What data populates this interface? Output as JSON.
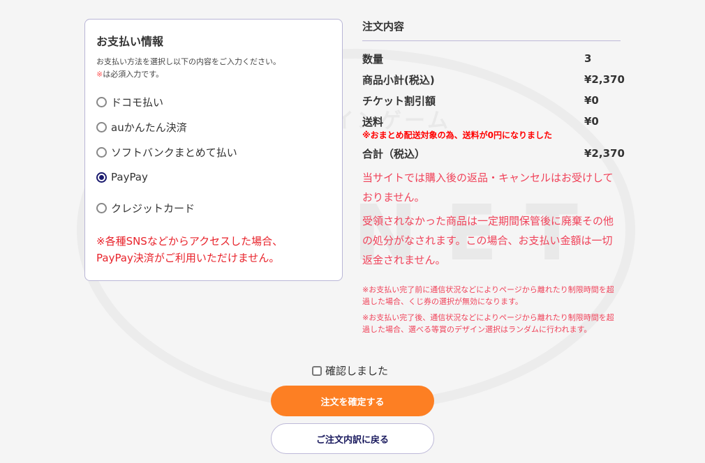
{
  "watermark": {
    "line1": "オンラインゲーム",
    "line2": "PLANET"
  },
  "payment": {
    "title": "お支払い情報",
    "description": "お支払い方法を選択し以下の内容をご入力ください。",
    "required_mark": "※",
    "required_text": "は必須入力です。",
    "options": [
      {
        "label": "ドコモ払い",
        "selected": false
      },
      {
        "label": "auかんたん決済",
        "selected": false
      },
      {
        "label": "ソフトバンクまとめて払い",
        "selected": false
      },
      {
        "label": "PayPay",
        "selected": true
      },
      {
        "label": "クレジットカード",
        "selected": false
      }
    ],
    "sns_warning_1": "※各種SNSなどからアクセスした場合、",
    "sns_warning_2": "PayPay決済がご利用いただけません。"
  },
  "order": {
    "title": "注文内容",
    "rows": [
      {
        "label": "数量",
        "value": "3"
      },
      {
        "label": "商品小計(税込)",
        "value": "¥2,370"
      },
      {
        "label": "チケット割引額",
        "value": "¥0"
      },
      {
        "label": "送料",
        "value": "¥0"
      }
    ],
    "shipping_note": "※おまとめ配送対象の為、送料が0円になりました",
    "total": {
      "label": "合計（税込）",
      "value": "¥2,370"
    },
    "notice_1": "当サイトでは購入後の返品・キャンセルはお受けしておりません。",
    "notice_2": "受領されなかった商品は一定期間保管後に廃棄その他の処分がなされます。この場合、お支払い金額は一切返金されません。",
    "small_1": "※お支払い完了前に通信状況などによりページから離れたり制限時間を超過した場合、くじ券の選択が無効になります。",
    "small_2": "※お支払い完了後、通信状況などによりページから離れたり制限時間を超過した場合、選べる等賞のデザイン選択はランダムに行われます。"
  },
  "confirm": {
    "label": "確認しました",
    "checked": false
  },
  "buttons": {
    "submit": "注文を確定する",
    "back": "ご注文内訳に戻る"
  },
  "colors": {
    "accent": "#fd7f23",
    "warning": "#e8232b",
    "selected_radio": "#1a1a6e"
  }
}
